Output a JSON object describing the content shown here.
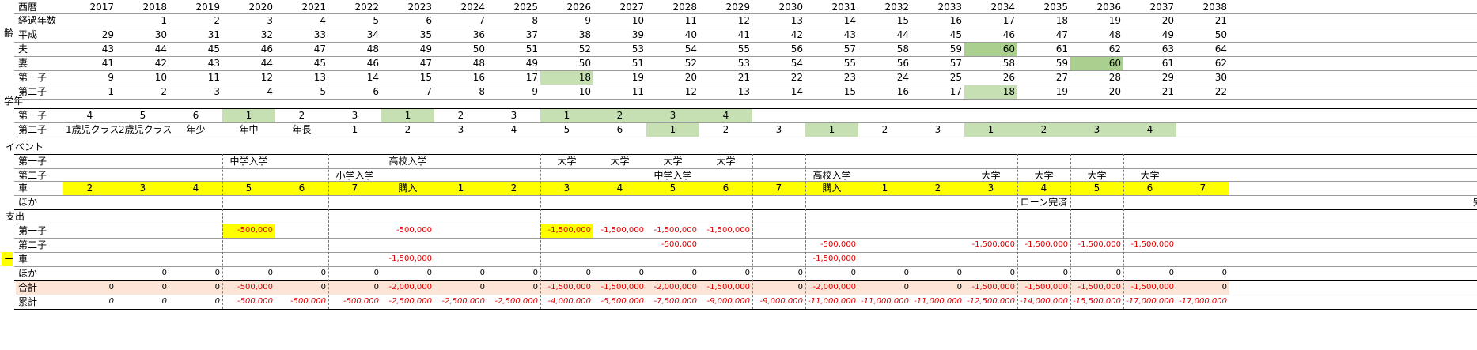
{
  "colors": {
    "light_green": "#c6e0b4",
    "green": "#a9d08e",
    "yellow": "#ffff00",
    "total_row": "#fce4d6",
    "negative": "#e00000"
  },
  "side_labels": {
    "age": "齢",
    "grade": "学年",
    "event": "イベント",
    "expense": "支出",
    "marker": "ー"
  },
  "header": {
    "row_label": "西暦",
    "years": [
      "2017",
      "2018",
      "2019",
      "2020",
      "2021",
      "2022",
      "2023",
      "2024",
      "2025",
      "2026",
      "2027",
      "2028",
      "2029",
      "2030",
      "2031",
      "2032",
      "2033",
      "2034",
      "2035",
      "2036",
      "2037",
      "2038"
    ]
  },
  "elapsed": {
    "label": "経過年数",
    "values": [
      "",
      "1",
      "2",
      "3",
      "4",
      "5",
      "6",
      "7",
      "8",
      "9",
      "10",
      "11",
      "12",
      "13",
      "14",
      "15",
      "16",
      "17",
      "18",
      "19",
      "20",
      "21"
    ]
  },
  "heisei": {
    "label": "平成",
    "values": [
      "29",
      "30",
      "31",
      "32",
      "33",
      "34",
      "35",
      "36",
      "37",
      "38",
      "39",
      "40",
      "41",
      "42",
      "43",
      "44",
      "45",
      "46",
      "47",
      "48",
      "49",
      "50"
    ]
  },
  "husband": {
    "label": "夫",
    "values": [
      "43",
      "44",
      "45",
      "46",
      "47",
      "48",
      "49",
      "50",
      "51",
      "52",
      "53",
      "54",
      "55",
      "56",
      "57",
      "58",
      "59",
      "60",
      "61",
      "62",
      "63",
      "64"
    ]
  },
  "wife": {
    "label": "妻",
    "values": [
      "41",
      "42",
      "43",
      "44",
      "45",
      "46",
      "47",
      "48",
      "49",
      "50",
      "51",
      "52",
      "53",
      "54",
      "55",
      "56",
      "57",
      "58",
      "59",
      "60",
      "61",
      "62"
    ]
  },
  "child1_age": {
    "label": "第一子",
    "values": [
      "9",
      "10",
      "11",
      "12",
      "13",
      "14",
      "15",
      "16",
      "17",
      "18",
      "19",
      "20",
      "21",
      "22",
      "23",
      "24",
      "25",
      "26",
      "27",
      "28",
      "29",
      "30"
    ]
  },
  "child2_age": {
    "label": "第二子",
    "values": [
      "1",
      "2",
      "3",
      "4",
      "5",
      "6",
      "7",
      "8",
      "9",
      "10",
      "11",
      "12",
      "13",
      "14",
      "15",
      "16",
      "17",
      "18",
      "19",
      "20",
      "21",
      "22"
    ]
  },
  "grade_child1": {
    "label": "第一子",
    "values": [
      "4",
      "5",
      "6",
      "1",
      "2",
      "3",
      "1",
      "2",
      "3",
      "1",
      "2",
      "3",
      "4",
      "",
      "",
      "",
      "",
      "",
      "",
      "",
      "",
      ""
    ]
  },
  "grade_child2": {
    "label": "第二子",
    "values": [
      "1歳児クラス",
      "2歳児クラス",
      "年少",
      "年中",
      "年長",
      "1",
      "2",
      "3",
      "4",
      "5",
      "6",
      "1",
      "2",
      "3",
      "1",
      "2",
      "3",
      "1",
      "2",
      "3",
      "4",
      ""
    ]
  },
  "event_child1": {
    "label": "第一子",
    "values": [
      "",
      "",
      "",
      "中学入学",
      "",
      "",
      "高校入学",
      "",
      "",
      "大学",
      "大学",
      "大学",
      "大学",
      "",
      "",
      "",
      "",
      "",
      "",
      "",
      "",
      ""
    ]
  },
  "event_child2": {
    "label": "第二子",
    "values": [
      "",
      "",
      "",
      "",
      "",
      "小学入学",
      "",
      "",
      "",
      "",
      "",
      "中学入学",
      "",
      "",
      "高校入学",
      "",
      "",
      "大学",
      "大学",
      "大学",
      "大学",
      ""
    ]
  },
  "event_car": {
    "label": "車",
    "values": [
      "2",
      "3",
      "4",
      "5",
      "6",
      "7",
      "購入",
      "1",
      "2",
      "3",
      "4",
      "5",
      "6",
      "7",
      "購入",
      "1",
      "2",
      "3",
      "4",
      "5",
      "6",
      "7"
    ]
  },
  "event_other": {
    "label": "ほか",
    "values": [
      "",
      "",
      "",
      "",
      "",
      "",
      "",
      "",
      "",
      "",
      "",
      "",
      "",
      "",
      "",
      "",
      "",
      "",
      "ローン完済",
      "",
      "",
      ""
    ],
    "overflow": "完"
  },
  "exp_child1": {
    "label": "第一子",
    "values": [
      "",
      "",
      "",
      "-500,000",
      "",
      "",
      "-500,000",
      "",
      "",
      "-1,500,000",
      "-1,500,000",
      "-1,500,000",
      "-1,500,000",
      "",
      "",
      "",
      "",
      "",
      "",
      "",
      "",
      ""
    ]
  },
  "exp_child2": {
    "label": "第二子",
    "values": [
      "",
      "",
      "",
      "",
      "",
      "",
      "",
      "",
      "",
      "",
      "",
      "-500,000",
      "",
      "",
      "-500,000",
      "",
      "",
      "-1,500,000",
      "-1,500,000",
      "-1,500,000",
      "-1,500,000",
      ""
    ]
  },
  "exp_car": {
    "label": "車",
    "values": [
      "",
      "",
      "",
      "",
      "",
      "",
      "-1,500,000",
      "",
      "",
      "",
      "",
      "",
      "",
      "",
      "-1,500,000",
      "",
      "",
      "",
      "",
      "",
      "",
      ""
    ]
  },
  "exp_other": {
    "label": "ほか",
    "values": [
      "",
      "0",
      "0",
      "0",
      "0",
      "0",
      "0",
      "0",
      "0",
      "0",
      "0",
      "0",
      "0",
      "0",
      "0",
      "0",
      "0",
      "0",
      "0",
      "0",
      "0",
      "0"
    ]
  },
  "exp_total": {
    "label": "合計",
    "values": [
      "0",
      "0",
      "0",
      "-500,000",
      "0",
      "0",
      "-2,000,000",
      "0",
      "0",
      "-1,500,000",
      "-1,500,000",
      "-2,000,000",
      "-1,500,000",
      "0",
      "-2,000,000",
      "0",
      "0",
      "-1,500,000",
      "-1,500,000",
      "-1,500,000",
      "-1,500,000",
      "0"
    ]
  },
  "exp_cumulative": {
    "label": "累計",
    "values": [
      "0",
      "0",
      "0",
      "-500,000",
      "-500,000",
      "-500,000",
      "-2,500,000",
      "-2,500,000",
      "-2,500,000",
      "-4,000,000",
      "-5,500,000",
      "-7,500,000",
      "-9,000,000",
      "-9,000,000",
      "-11,000,000",
      "-11,000,000",
      "-11,000,000",
      "-12,500,000",
      "-14,000,000",
      "-15,500,000",
      "-17,000,000",
      "-17,000,000"
    ]
  }
}
